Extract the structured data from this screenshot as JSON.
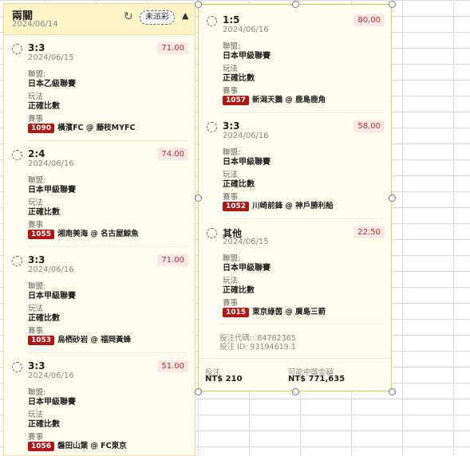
{
  "slip": {
    "title": "兩關",
    "date": "2024/06/14",
    "status_pill": "未派彩"
  },
  "labels": {
    "league": "聯盟:",
    "play": "玩法",
    "match": "賽事"
  },
  "left_bets": [
    {
      "score": "3:3",
      "date": "2024/06/15",
      "odds": "71.00",
      "league": "日本乙級聯賽",
      "play": "正確比數",
      "code": "1090",
      "match": "橫濱FC @ 藤枝MYFC"
    },
    {
      "score": "2:4",
      "date": "2024/06/16",
      "odds": "74.00",
      "league": "日本甲級聯賽",
      "play": "正確比數",
      "code": "1055",
      "match": "湘南美海 @ 名古屋鯨魚"
    },
    {
      "score": "3:3",
      "date": "2024/06/16",
      "odds": "71.00",
      "league": "日本甲級聯賽",
      "play": "正確比數",
      "code": "1053",
      "match": "烏栖砂岩 @ 福岡黃蜂"
    },
    {
      "score": "3:3",
      "date": "2024/06/16",
      "odds": "51.00",
      "league": "日本甲級聯賽",
      "play": "正確比數",
      "code": "1056",
      "match": "磐田山葉 @ FC東京"
    }
  ],
  "right_bets": [
    {
      "score": "1:5",
      "date": "2024/06/16",
      "odds": "80.00",
      "league": "日本甲級聯賽",
      "play": "正確比數",
      "code": "1057",
      "match": "新潟天鵝 @ 鹿島鹿角"
    },
    {
      "score": "3:3",
      "date": "2024/06/16",
      "odds": "58.00",
      "league": "日本甲級聯賽",
      "play": "正確比數",
      "code": "1052",
      "match": "川崎前鋒 @ 神戶勝利船"
    },
    {
      "score": "其他",
      "date": "2024/06/15",
      "odds": "22.50",
      "league": "日本甲級聯賽",
      "play": "正確比數",
      "code": "1015",
      "match": "東京綠茵 @ 廣島三箭"
    }
  ],
  "footer": {
    "proxy_code": "投注代碼:: 84782365",
    "bet_id": "投注 ID: 93194619.1",
    "stake_label": "投注",
    "stake_value": "NT$ 210",
    "payout_label": "可能中獎金額",
    "payout_value": "NT$ 771,635"
  }
}
